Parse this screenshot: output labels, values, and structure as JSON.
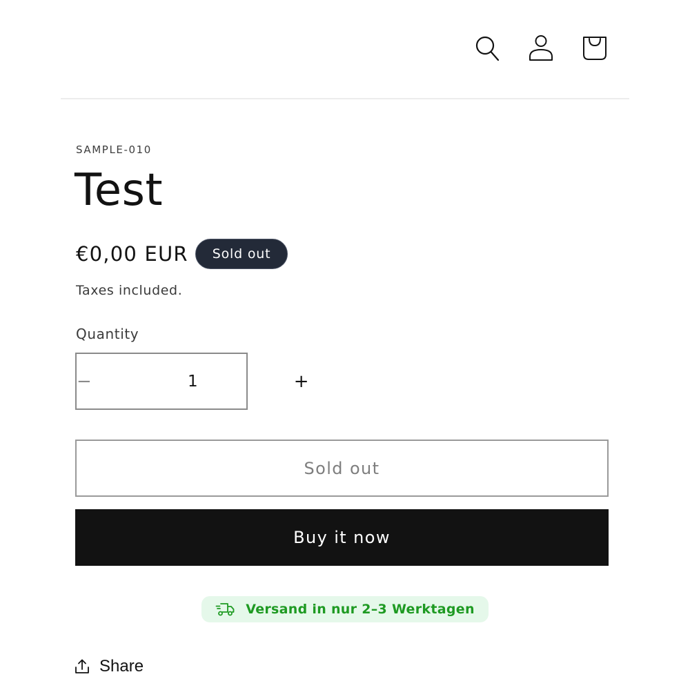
{
  "header": {
    "icons": [
      "search-icon",
      "account-icon",
      "cart-icon"
    ]
  },
  "product": {
    "vendor": "SAMPLE-010",
    "title": "Test",
    "price": "€0,00 EUR",
    "badge": "Sold out",
    "taxes_note": "Taxes included."
  },
  "quantity": {
    "label": "Quantity",
    "value": "1",
    "minus_symbol": "−",
    "plus_symbol": "+"
  },
  "buttons": {
    "add_to_cart_label": "Sold out",
    "buy_now_label": "Buy it now"
  },
  "shipping": {
    "text": "Versand in nur 2–3 Werktagen",
    "icon": "delivery-truck-icon",
    "color": "#1e9a22",
    "background": "#e5f8ea"
  },
  "share": {
    "label": "Share",
    "icon": "share-upload-icon"
  },
  "colors": {
    "text": "#121212",
    "badge_background": "#232a38",
    "buy_button_background": "#121212",
    "divider": "#ececec"
  }
}
